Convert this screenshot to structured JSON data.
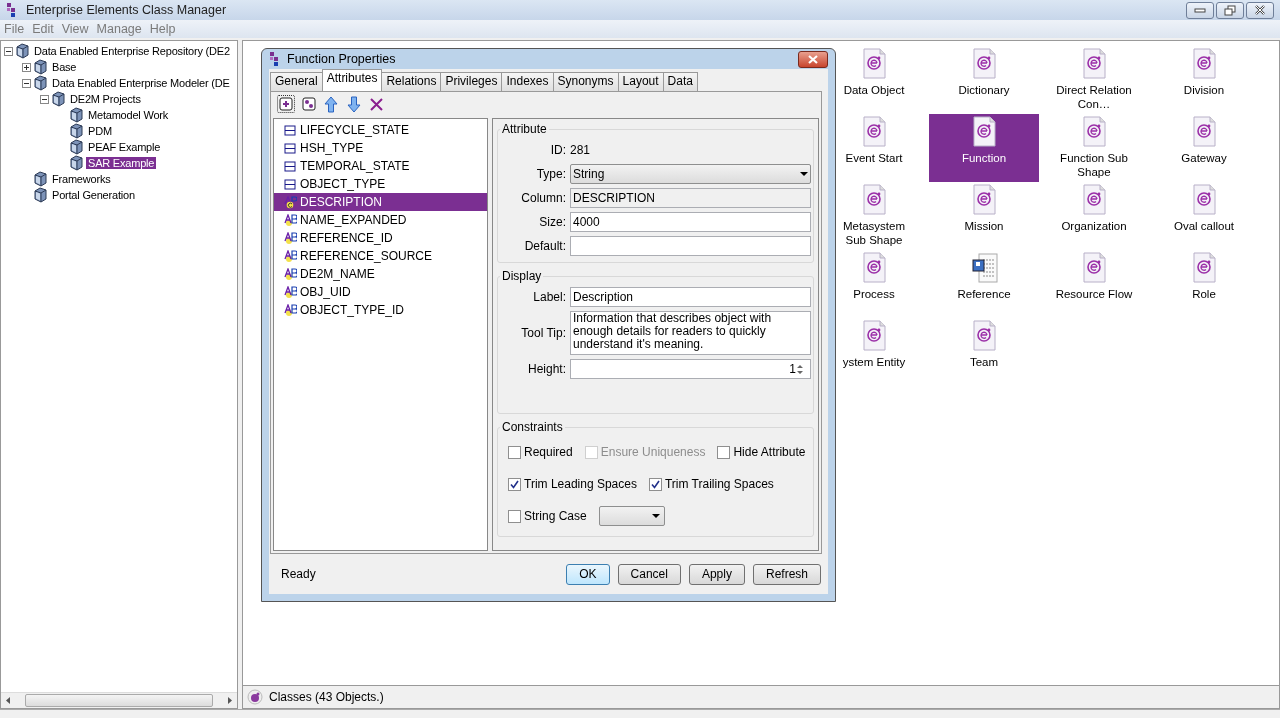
{
  "window": {
    "title": "Enterprise Elements Class Manager"
  },
  "menu": [
    {
      "label": "File"
    },
    {
      "label": "Edit"
    },
    {
      "label": "View"
    },
    {
      "label": "Manage"
    },
    {
      "label": "Help"
    }
  ],
  "tree": [
    {
      "label": "Data Enabled Enterprise Repository (DE2",
      "expanded": true,
      "selected": false,
      "children": [
        {
          "label": "Base",
          "expanded": false,
          "selected": false
        },
        {
          "label": "Data Enabled Enterprise Modeler (DE",
          "expanded": true,
          "selected": false,
          "children": [
            {
              "label": "DE2M Projects",
              "expanded": true,
              "selected": false,
              "children": [
                {
                  "label": "Metamodel Work",
                  "selected": false
                },
                {
                  "label": "PDM",
                  "selected": false
                },
                {
                  "label": "PEAF Example",
                  "selected": false
                },
                {
                  "label": "SAR Example",
                  "selected": true
                }
              ]
            }
          ]
        },
        {
          "label": "Frameworks",
          "selected": false
        },
        {
          "label": "Portal Generation",
          "selected": false
        }
      ]
    }
  ],
  "classes": [
    {
      "label": "Data Object",
      "kind": "class",
      "selected": false
    },
    {
      "label": "Dictionary",
      "kind": "class",
      "selected": false
    },
    {
      "label": "Direct Relation Con…",
      "kind": "class",
      "selected": false
    },
    {
      "label": "Division",
      "kind": "class",
      "selected": false
    },
    {
      "label": "Event Start",
      "kind": "class",
      "selected": false
    },
    {
      "label": "Function",
      "kind": "class",
      "selected": true
    },
    {
      "label": "Function Sub Shape",
      "kind": "class",
      "selected": false
    },
    {
      "label": "Gateway",
      "kind": "class",
      "selected": false
    },
    {
      "label": "Metasystem Sub Shape",
      "kind": "class",
      "selected": false
    },
    {
      "label": "Mission",
      "kind": "class",
      "selected": false
    },
    {
      "label": "Organization",
      "kind": "class",
      "selected": false
    },
    {
      "label": "Oval callout",
      "kind": "class",
      "selected": false
    },
    {
      "label": "Process",
      "kind": "class",
      "selected": false
    },
    {
      "label": "Reference",
      "kind": "reference",
      "selected": false
    },
    {
      "label": "Resource Flow",
      "kind": "class",
      "selected": false
    },
    {
      "label": "Role",
      "kind": "class",
      "selected": false
    },
    {
      "label": "ystem Entity",
      "kind": "class",
      "selected": false
    },
    {
      "label": "Team",
      "kind": "class",
      "selected": false
    }
  ],
  "status_bar": {
    "text": "Classes (43 Objects.)"
  },
  "dialog": {
    "title": "Function Properties",
    "tabs": [
      {
        "label": "General",
        "selected": false
      },
      {
        "label": "Attributes",
        "selected": true
      },
      {
        "label": "Relations",
        "selected": false
      },
      {
        "label": "Privileges",
        "selected": false
      },
      {
        "label": "Indexes",
        "selected": false
      },
      {
        "label": "Synonyms",
        "selected": false
      },
      {
        "label": "Layout",
        "selected": false
      },
      {
        "label": "Data",
        "selected": false
      }
    ],
    "attributes": [
      {
        "name": "LIFECYCLE_STATE",
        "kind": "column",
        "selected": false
      },
      {
        "name": "HSH_TYPE",
        "kind": "column",
        "selected": false
      },
      {
        "name": "TEMPORAL_STATE",
        "kind": "column",
        "selected": false
      },
      {
        "name": "OBJECT_TYPE",
        "kind": "column",
        "selected": false
      },
      {
        "name": "DESCRIPTION",
        "kind": "text-c",
        "selected": true
      },
      {
        "name": "NAME_EXPANDED",
        "kind": "text",
        "selected": false
      },
      {
        "name": "REFERENCE_ID",
        "kind": "text",
        "selected": false
      },
      {
        "name": "REFERENCE_SOURCE",
        "kind": "text",
        "selected": false
      },
      {
        "name": "DE2M_NAME",
        "kind": "text",
        "selected": false
      },
      {
        "name": "OBJ_UID",
        "kind": "text",
        "selected": false
      },
      {
        "name": "OBJECT_TYPE_ID",
        "kind": "text",
        "selected": false
      }
    ],
    "attribute": {
      "legend": "Attribute",
      "id_label": "ID:",
      "id_value": "281",
      "type_label": "Type:",
      "type_value": "String",
      "column_label": "Column:",
      "column_value": "DESCRIPTION",
      "size_label": "Size:",
      "size_value": "4000",
      "default_label": "Default:"
    },
    "display": {
      "legend": "Display",
      "label_label": "Label:",
      "label_value": "Description",
      "tooltip_label": "Tool Tip:",
      "tooltip_value": "Information that describes object with enough details for readers to quickly understand it's meaning.",
      "height_label": "Height:",
      "height_value": "1"
    },
    "constraints": {
      "legend": "Constraints",
      "checks": [
        {
          "label": "Required",
          "checked": false,
          "disabled": false
        },
        {
          "label": "Ensure Uniqueness",
          "checked": false,
          "disabled": true
        },
        {
          "label": "Hide Attribute",
          "checked": false,
          "disabled": false
        },
        {
          "label": "Trim Leading Spaces",
          "checked": true,
          "disabled": false
        },
        {
          "label": "Trim Trailing Spaces",
          "checked": true,
          "disabled": false
        },
        {
          "label": "String Case",
          "checked": false,
          "disabled": false
        }
      ]
    },
    "status": "Ready",
    "buttons": [
      {
        "label": "OK",
        "default": true
      },
      {
        "label": "Cancel",
        "default": false
      },
      {
        "label": "Apply",
        "default": false
      },
      {
        "label": "Refresh",
        "default": false
      }
    ]
  }
}
